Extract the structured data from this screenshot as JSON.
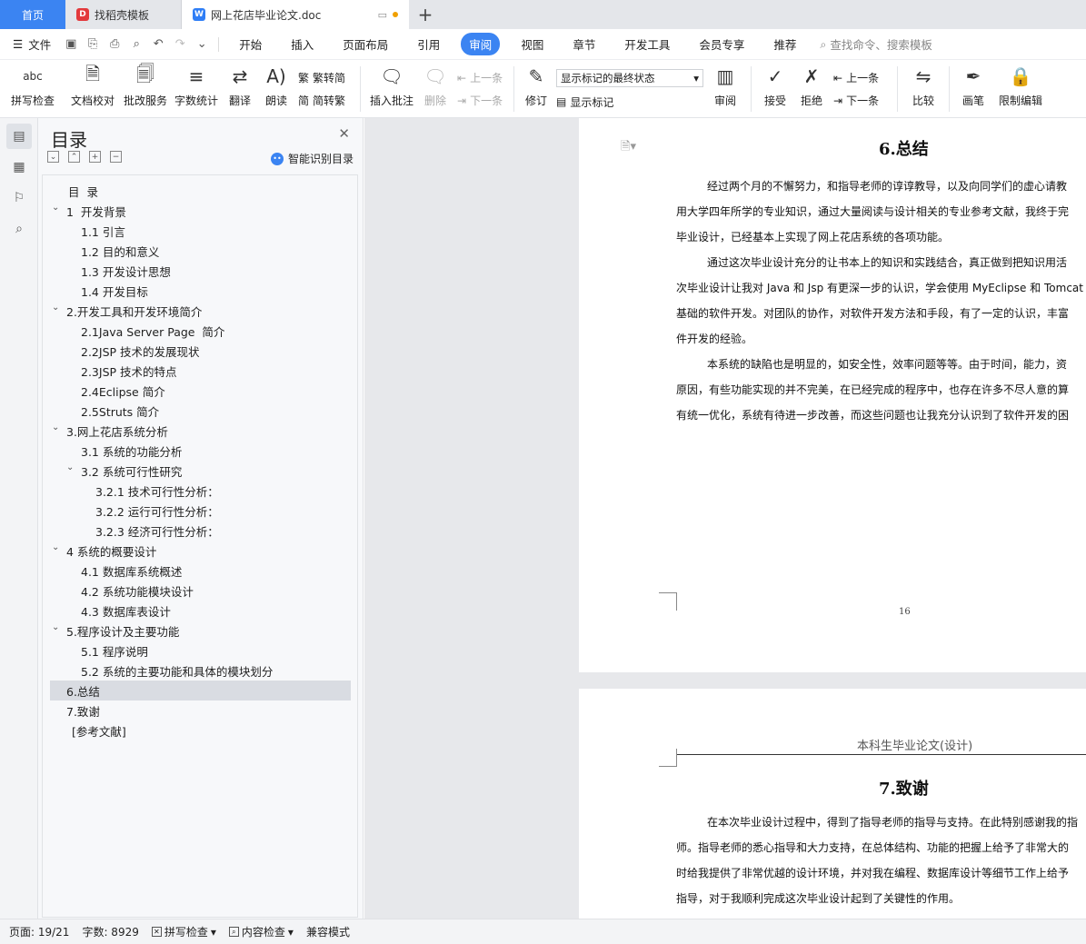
{
  "tabs": {
    "home": "首页",
    "tab1": "找稻壳模板",
    "tab2": "网上花店毕业论文.doc",
    "add": "+"
  },
  "menubar": {
    "file": "文件",
    "items": [
      "开始",
      "插入",
      "页面布局",
      "引用",
      "审阅",
      "视图",
      "章节",
      "开发工具",
      "会员专享",
      "推荐"
    ],
    "active": "审阅",
    "search": "查找命令、搜索模板"
  },
  "ribbon": {
    "spell_check": "拼写检查",
    "doc_proof": "文档校对",
    "batch_service": "批改服务",
    "word_count": "字数统计",
    "translate": "翻译",
    "read_aloud": "朗读",
    "trad_to_simp": "繁转简",
    "simp_to_trad": "简转繁",
    "insert_comment": "插入批注",
    "delete": "删除",
    "prev": "上一条",
    "next": "下一条",
    "revise": "修订",
    "markup_state": "显示标记的最终状态",
    "show_markup": "显示标记",
    "review": "审阅",
    "accept": "接受",
    "reject": "拒绝",
    "prev2": "上一条",
    "next2": "下一条",
    "compare": "比较",
    "pen": "画笔",
    "restrict": "限制编辑"
  },
  "toc": {
    "title": "目录",
    "smart": "智能识别目录",
    "items": [
      {
        "text": "目  录",
        "level": 0,
        "chev": false
      },
      {
        "text": "1  开发背景",
        "level": 1,
        "chev": true
      },
      {
        "text": "1.1 引言",
        "level": 2,
        "chev": false
      },
      {
        "text": "1.2 目的和意义",
        "level": 2,
        "chev": false
      },
      {
        "text": "1.3 开发设计思想",
        "level": 2,
        "chev": false
      },
      {
        "text": "1.4 开发目标",
        "level": 2,
        "chev": false
      },
      {
        "text": "2.开发工具和开发环境简介",
        "level": 1,
        "chev": true
      },
      {
        "text": "2.1Java Server Page  简介",
        "level": 2,
        "chev": false
      },
      {
        "text": "2.2JSP 技术的发展现状",
        "level": 2,
        "chev": false
      },
      {
        "text": "2.3JSP 技术的特点",
        "level": 2,
        "chev": false
      },
      {
        "text": "2.4Eclipse 简介",
        "level": 2,
        "chev": false
      },
      {
        "text": "2.5Struts 简介",
        "level": 2,
        "chev": false
      },
      {
        "text": "3.网上花店系统分析",
        "level": 1,
        "chev": true
      },
      {
        "text": "3.1 系统的功能分析",
        "level": 2,
        "chev": false
      },
      {
        "text": "3.2 系统可行性研究",
        "level": 2,
        "chev": true
      },
      {
        "text": "3.2.1 技术可行性分析：",
        "level": 3,
        "chev": false
      },
      {
        "text": "3.2.2 运行可行性分析：",
        "level": 3,
        "chev": false
      },
      {
        "text": "3.2.3 经济可行性分析：",
        "level": 3,
        "chev": false
      },
      {
        "text": "4 系统的概要设计",
        "level": 1,
        "chev": true
      },
      {
        "text": "4.1 数据库系统概述",
        "level": 2,
        "chev": false
      },
      {
        "text": "4.2 系统功能模块设计",
        "level": 2,
        "chev": false
      },
      {
        "text": "4.3 数据库表设计",
        "level": 2,
        "chev": false
      },
      {
        "text": "5.程序设计及主要功能",
        "level": 1,
        "chev": true
      },
      {
        "text": "5.1 程序说明",
        "level": 2,
        "chev": false
      },
      {
        "text": "5.2 系统的主要功能和具体的模块划分",
        "level": 2,
        "chev": false
      },
      {
        "text": "6.总结",
        "level": 1,
        "chev": false,
        "selected": true
      },
      {
        "text": "7.致谢",
        "level": 1,
        "chev": false
      },
      {
        "text": "[参考文献]",
        "level": 1.4,
        "chev": false
      }
    ]
  },
  "doc": {
    "page1_title": "6.总结",
    "page1_lines": [
      {
        "indent": true,
        "text": "经过两个月的不懈努力，和指导老师的谆谆教导，以及向同学们的虚心请教"
      },
      {
        "indent": false,
        "text": "用大学四年所学的专业知识，通过大量阅读与设计相关的专业参考文献，我终于完"
      },
      {
        "indent": false,
        "text": "毕业设计，已经基本上实现了网上花店系统的各项功能。"
      },
      {
        "indent": true,
        "text": "通过这次毕业设计充分的让书本上的知识和实践结合，真正做到把知识用活"
      },
      {
        "indent": false,
        "text": "次毕业设计让我对 Java 和 Jsp 有更深一步的认识，学会使用 MyEclipse 和 Tomcat"
      },
      {
        "indent": false,
        "text": "基础的软件开发。对团队的协作，对软件开发方法和手段，有了一定的认识，丰富"
      },
      {
        "indent": false,
        "text": "件开发的经验。"
      },
      {
        "indent": true,
        "text": "本系统的缺陷也是明显的，如安全性，效率问题等等。由于时间，能力，资"
      },
      {
        "indent": false,
        "text": "原因，有些功能实现的并不完美，在已经完成的程序中，也存在许多不尽人意的算"
      },
      {
        "indent": false,
        "text": "有统一优化，系统有待进一步改善，而这些问题也让我充分认识到了软件开发的困"
      }
    ],
    "page_number": "16",
    "page2_header": "本科生毕业论文(设计)",
    "page2_title": "7.致谢",
    "page2_lines": [
      {
        "indent": true,
        "text": "在本次毕业设计过程中，得到了指导老师的指导与支持。在此特别感谢我的指"
      },
      {
        "indent": false,
        "text": "师。指导老师的悉心指导和大力支持，在总体结构、功能的把握上给予了非常大的"
      },
      {
        "indent": false,
        "text": "时给我提供了非常优越的设计环境，并对我在编程、数据库设计等细节工作上给予"
      },
      {
        "indent": false,
        "text": "指导，对于我顺利完成这次毕业设计起到了关键性的作用。"
      }
    ]
  },
  "status": {
    "page": "页面: 19/21",
    "words": "字数: 8929",
    "spell": "拼写检查",
    "content": "内容检查",
    "compat": "兼容模式"
  }
}
